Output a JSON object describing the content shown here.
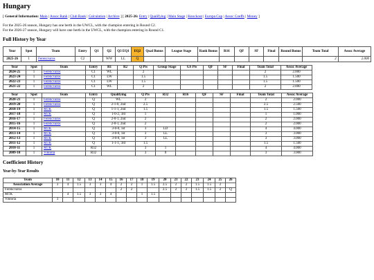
{
  "title": "Hungary",
  "nav": {
    "open": "[",
    "general_label": "General Information:",
    "general_links": [
      "Main",
      "Assoc Rank",
      "Club Rank",
      "Calculation",
      "Archive"
    ],
    "mid": "] [",
    "season_label": "2025-26:",
    "season_links": [
      "Entry",
      "Qualifying",
      "Main Stage",
      "Knockout",
      "Europa Cup",
      "Assoc Coeffs",
      "Money"
    ],
    "close": "]"
  },
  "intro": [
    "For the 2025-26 season, Hungary has one berth in the UWCL, with the champion entering in Round C2.",
    "For the 2026-27 season, Hungary will have one berth in the UWCL, with the champion entering in Round C1."
  ],
  "full_history_heading": "Full History by Year",
  "current_table": {
    "headers": [
      "Year",
      "Spot",
      "Team",
      "Entry",
      "Q1",
      "Q2",
      "Q3 EQ1",
      "EQ2",
      "Qual Bonus",
      "League Stage",
      "Rank Bonus",
      "R16",
      "QF",
      "SF",
      "Final",
      "Round Bonus",
      "Team Total",
      "Assoc Average"
    ],
    "rows": [
      [
        "2025-26",
        "1",
        "Ferencvaros",
        "C2",
        "",
        "WW",
        "LL",
        "Q",
        "",
        "",
        "",
        "",
        "",
        "",
        "",
        "",
        "2",
        "2.000"
      ]
    ]
  },
  "mid_table": {
    "headers": [
      "Year",
      "Spot",
      "Team",
      "Entry",
      "R1",
      "R2",
      "Q Pts",
      "Group Stage",
      "GS Pts",
      "QF",
      "SF",
      "Final",
      "Team Total",
      "Assoc Average"
    ],
    "rows": [
      [
        "2024-25",
        "1",
        "Ferencvaros",
        "C1",
        "WL",
        "",
        "2",
        "",
        "",
        "",
        "",
        "",
        "2",
        "2.000"
      ],
      [
        "2023-24",
        "1",
        "Ferencvaros",
        "C1",
        "LW",
        "",
        "1.5",
        "",
        "",
        "",
        "",
        "",
        "1.5",
        "1.500"
      ],
      [
        "2022-23",
        "1",
        "Ferencvaros",
        "C1",
        "LW",
        "",
        "1.5",
        "",
        "",
        "",
        "",
        "",
        "1.5",
        "1.500"
      ],
      [
        "2021-22",
        "1",
        "Ferencvaros",
        "C1",
        "WL",
        "",
        "2",
        "",
        "",
        "",
        "",
        "",
        "2",
        "2.000"
      ]
    ]
  },
  "old_table": {
    "headers": [
      "Year",
      "Spot",
      "Team",
      "Entry",
      "Qualifying",
      "Q Pts",
      "R32",
      "R16",
      "QF",
      "SF",
      "Final",
      "Team Total",
      "Assoc Average"
    ],
    "rows": [
      [
        "2020-21",
        "1",
        "Ferencvaros",
        "Q",
        "WL",
        "2",
        "",
        "",
        "",
        "",
        "",
        "2",
        "2.000"
      ],
      [
        "2019-20",
        "1",
        "Ferencvaros",
        "Q",
        "2-1-0, 2nd",
        "2.5",
        "",
        "",
        "",
        "",
        "",
        "2.5",
        "2.500"
      ],
      [
        "2018-19",
        "1",
        "MTK",
        "Q",
        "1-1-1, 2nd",
        "1.5",
        "",
        "",
        "",
        "",
        "",
        "1.5",
        "1.500"
      ],
      [
        "2017-18",
        "1",
        "MTK",
        "Q",
        "1-0-2, 3rd",
        "1",
        "",
        "",
        "",
        "",
        "",
        "1",
        "1.000"
      ],
      [
        "2016-17",
        "1",
        "Ferencvaros",
        "Q",
        "2-0-1, 2nd",
        "2",
        "",
        "",
        "",
        "",
        "",
        "2",
        "2.000"
      ],
      [
        "2015-16",
        "1",
        "Ferencvaros",
        "Q",
        "2-0-1, 2nd",
        "2",
        "",
        "",
        "",
        "",
        "",
        "2",
        "2.000"
      ],
      [
        "2014-15",
        "1",
        "MTK",
        "Q",
        "3-0-0, 1st",
        "3",
        "LD",
        "",
        "",
        "",
        "",
        "4",
        "4.000"
      ],
      [
        "2013-14",
        "1",
        "MTK",
        "Q",
        "3-0-0, 1st",
        "3",
        "LL",
        "",
        "",
        "",
        "",
        "3",
        "3.000"
      ],
      [
        "2012-13",
        "1",
        "MTK",
        "Q",
        "3-0-0, 1st",
        "3",
        "LL",
        "",
        "",
        "",
        "",
        "3",
        "3.000"
      ],
      [
        "2011-12",
        "1",
        "MTK",
        "Q",
        "1-1-1, 3rd",
        "1.5",
        "",
        "",
        "",
        "",
        "",
        "1.5",
        "1.500"
      ],
      [
        "2010-11",
        "1",
        "MTK",
        "R32",
        "",
        "3",
        "1",
        "",
        "",
        "",
        "",
        "4",
        "4.000"
      ],
      [
        "2009-10",
        "1",
        "Viktoria",
        "R32",
        "",
        "3",
        "0",
        "",
        "",
        "",
        "",
        "3",
        "3.000"
      ]
    ]
  },
  "coefficient_heading": "Coefficient History",
  "yby_heading": "Year-by-Year Results",
  "coef_table": {
    "headers": [
      "Team",
      "10",
      "11",
      "12",
      "13",
      "14",
      "15",
      "16",
      "17",
      "18",
      "19",
      "20",
      "21",
      "22",
      "23",
      "24",
      "25",
      "26"
    ],
    "rows": [
      [
        "Association Average",
        "3",
        "4",
        "1.5",
        "3",
        "3",
        "4",
        "2",
        "2",
        "1",
        "1.5",
        "2.5",
        "2",
        "2",
        "1.5",
        "1.5",
        "2",
        ""
      ],
      [
        "Ferencvaros",
        "",
        "",
        "",
        "",
        "",
        "",
        "2",
        "2",
        "",
        "",
        "2.5",
        "2",
        "2",
        "1.5",
        "1.5",
        "2",
        "Q"
      ],
      [
        "MTK",
        "",
        "4",
        "1.5",
        "3",
        "3",
        "4",
        "",
        "",
        "1",
        "1.5",
        "",
        "",
        "",
        "",
        "",
        "",
        ""
      ],
      [
        "Viktoria",
        "3",
        "",
        "",
        "",
        "",
        "",
        "",
        "",
        "",
        "",
        "",
        "",
        "",
        "",
        "",
        "",
        ""
      ]
    ]
  },
  "colors": {
    "link": "#0000cc",
    "highlight": "#f7b32b"
  }
}
